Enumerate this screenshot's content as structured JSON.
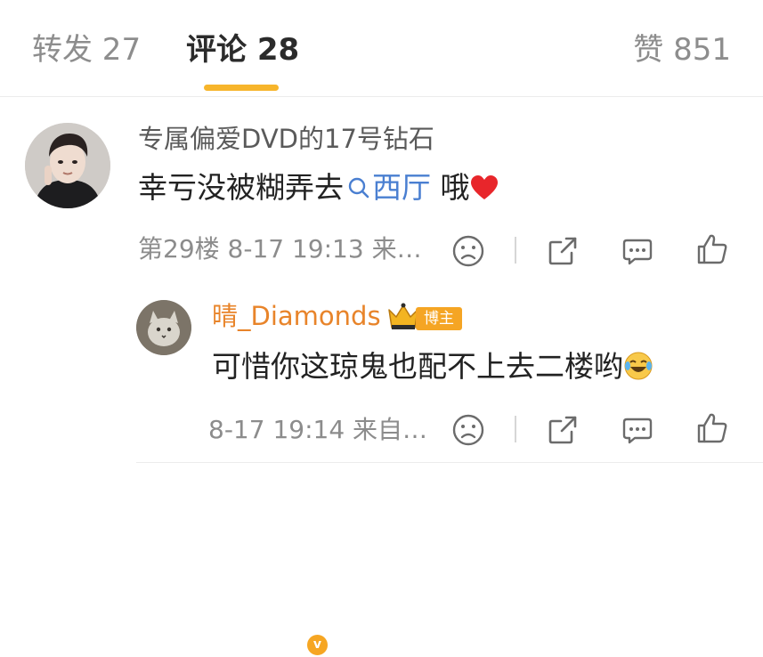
{
  "tabs": {
    "repost": "转发 27",
    "comment": "评论 28",
    "like": "赞 851"
  },
  "colors": {
    "accent": "#f7b52b",
    "link": "#4a7fd1",
    "vip_name": "#e8842a",
    "meta": "#8c8c8c"
  },
  "comments": [
    {
      "username": "专属偏爱DVD的17号钻石",
      "text_before": "幸亏没被糊弄去",
      "link_icon": "search-icon",
      "link_text": "西厅",
      "text_after": " 哦",
      "emoji": "heart-emoji",
      "meta": "第29楼 8-17 19:13 来…"
    },
    {
      "username": "晴_Diamonds",
      "badge": "博主",
      "text": "可惜你这琼鬼也配不上去二楼哟",
      "emoji": "laugh-tears-emoji",
      "meta": "8-17 19:14 来自…"
    }
  ],
  "actions": [
    "dislike-icon",
    "share-icon",
    "comment-icon",
    "like-icon"
  ]
}
